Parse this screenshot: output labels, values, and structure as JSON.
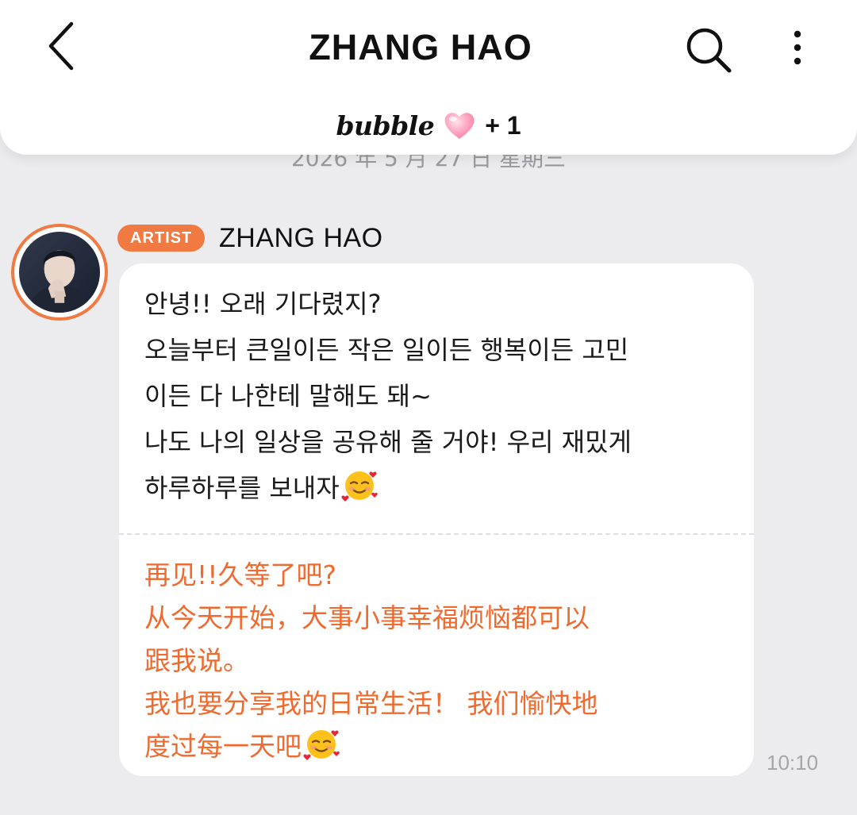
{
  "header": {
    "title": "ZHANG HAO",
    "bubble_label": "bubble",
    "bubble_count": "+ 1"
  },
  "date_divider": "2026 年 5 月 27 日 星期三",
  "message": {
    "badge": "ARTIST",
    "sender": "ZHANG HAO",
    "korean_lines": [
      "안녕!! 오래 기다렸지?",
      "오늘부터 큰일이든 작은 일이든 행복이든 고민",
      "이든 다 나한테 말해도 돼~",
      "나도 나의 일상을 공유해 줄 거야! 우리 재밌게",
      "하루하루를 보내자"
    ],
    "chinese_lines": [
      "再见!!久等了吧?",
      "从今天开始，大事小事幸福烦恼都可以",
      "跟我说。",
      "我也要分享我的日常生活！ 我们愉快地",
      "度过每一天吧"
    ],
    "time": "10:10"
  },
  "icons": {
    "back": "chevron-left-icon",
    "search": "search-icon",
    "more": "more-vertical-icon",
    "bubble_heart": "pink-heart-icon",
    "emoji": "smiling-face-with-hearts-emoji"
  },
  "colors": {
    "accent": "#f07a42",
    "translation_text": "#ef6a2f",
    "background": "#ececef"
  }
}
